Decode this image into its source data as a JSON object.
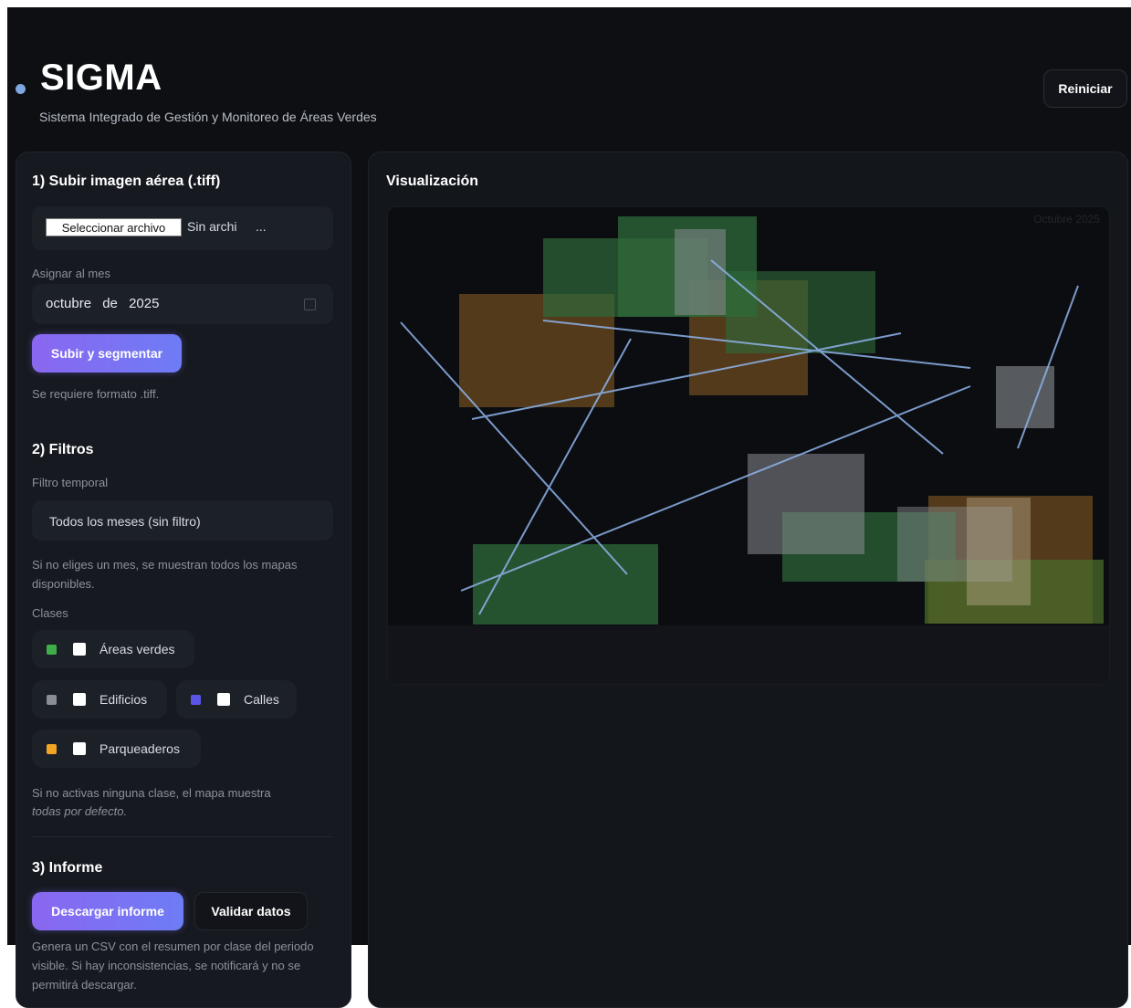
{
  "header": {
    "title": "SIGMA",
    "subtitle": "Sistema Integrado de Gestión y Monitoreo de Áreas Verdes",
    "reset_label": "Reiniciar"
  },
  "upload": {
    "section_title": "1) Subir imagen aérea (.tiff)",
    "file_button": "Seleccionar archivo",
    "file_status": "Sin archi",
    "file_ellipsis": "...",
    "month_label": "Asignar al mes",
    "month_value": "octubre",
    "month_sep": "de",
    "year_value": "2025",
    "submit_label": "Subir y segmentar",
    "format_note": "Se requiere formato .tiff."
  },
  "filters": {
    "section_title": "2) Filtros",
    "temporal_label": "Filtro temporal",
    "temporal_value": "Todos los meses (sin filtro)",
    "temporal_note": "Si no eliges un mes, se muestran todos los mapas disponibles.",
    "classes_label": "Clases",
    "classes": [
      {
        "label": "Áreas verdes",
        "color": "#3fae4a",
        "checked": false
      },
      {
        "label": "Edificios",
        "color": "#8a8d93",
        "checked": false
      },
      {
        "label": "Calles",
        "color": "#5b55e6",
        "checked": false
      },
      {
        "label": "Parqueaderos",
        "color": "#f2a524",
        "checked": false
      }
    ],
    "classes_note_1": "Si no activas ninguna clase, el mapa muestra",
    "classes_note_2": "todas por defecto."
  },
  "report": {
    "section_title": "3) Informe",
    "download_label": "Descargar informe",
    "validate_label": "Validar datos",
    "note": "Genera un CSV con el resumen por clase del periodo visible. Si hay inconsistencias, se notificará y no se permitirá descargar."
  },
  "visualization": {
    "title": "Visualización",
    "month_overlay": "Octubre 2025"
  }
}
